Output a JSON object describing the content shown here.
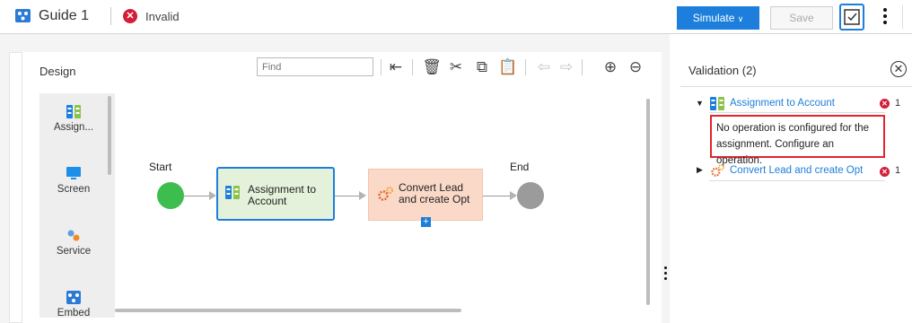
{
  "header": {
    "title": "Guide 1",
    "status": "Invalid",
    "simulate_label": "Simulate",
    "save_label": "Save"
  },
  "design": {
    "title": "Design",
    "find_placeholder": "Find"
  },
  "palette": {
    "items": [
      {
        "label": "Assign...",
        "icon": "assignment-icon"
      },
      {
        "label": "Screen",
        "icon": "screen-icon"
      },
      {
        "label": "Service",
        "icon": "service-icon"
      },
      {
        "label": "Embed",
        "icon": "embed-icon"
      }
    ]
  },
  "canvas": {
    "start_label": "Start",
    "end_label": "End",
    "assign_step": {
      "line1": "Assignment to",
      "line2": "Account"
    },
    "convert_step": {
      "line1": "Convert Lead",
      "line2": "and create Opt"
    },
    "add_symbol": "+"
  },
  "validation": {
    "title": "Validation (2)",
    "items": [
      {
        "label": "Assignment to Account",
        "count": "1",
        "message": "No operation is configured for the assignment. Configure an operation."
      },
      {
        "label": "Convert Lead and create Opt",
        "count": "1"
      }
    ]
  },
  "colors": {
    "accent": "#1d7fdb",
    "error": "#d31e38",
    "start": "#3ebd4f",
    "end": "#9b9b9b",
    "assign_fill": "#e4f2dc",
    "convert_fill": "#fbd9c8"
  }
}
